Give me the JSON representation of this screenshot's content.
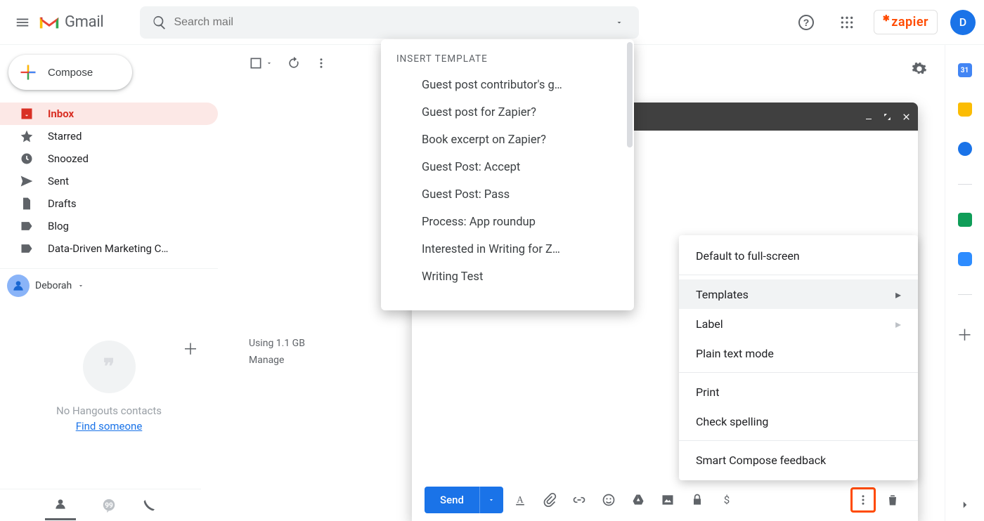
{
  "header": {
    "logo_text": "Gmail",
    "search_placeholder": "Search mail",
    "zapier_label": "zapier",
    "avatar_initial": "D"
  },
  "sidebar": {
    "compose_label": "Compose",
    "items": [
      {
        "label": "Inbox",
        "active": true
      },
      {
        "label": "Starred"
      },
      {
        "label": "Snoozed"
      },
      {
        "label": "Sent"
      },
      {
        "label": "Drafts"
      },
      {
        "label": "Blog"
      },
      {
        "label": "Data-Driven Marketing C…"
      }
    ],
    "user_name": "Deborah",
    "no_contacts": "No Hangouts contacts",
    "find_someone": "Find someone"
  },
  "storage": {
    "line1": "Using 1.1 GB",
    "line2": "Manage"
  },
  "compose": {
    "send_label": "Send"
  },
  "more_menu": {
    "items": [
      {
        "label": "Default to full-screen",
        "arrow": false,
        "section": 0
      },
      {
        "label": "Templates",
        "arrow": true,
        "hovered": true,
        "section": 1
      },
      {
        "label": "Label",
        "arrow": true,
        "section": 1
      },
      {
        "label": "Plain text mode",
        "arrow": false,
        "section": 1
      },
      {
        "label": "Print",
        "arrow": false,
        "section": 2
      },
      {
        "label": "Check spelling",
        "arrow": false,
        "section": 2
      },
      {
        "label": "Smart Compose feedback",
        "arrow": false,
        "section": 3
      }
    ]
  },
  "templates": {
    "header": "INSERT TEMPLATE",
    "items": [
      "Guest post contributor's g…",
      "Guest post for Zapier?",
      "Book excerpt on Zapier?",
      "Guest Post: Accept",
      "Guest Post: Pass",
      "Process: App roundup",
      "Interested in Writing for Z…",
      "Writing Test"
    ]
  }
}
